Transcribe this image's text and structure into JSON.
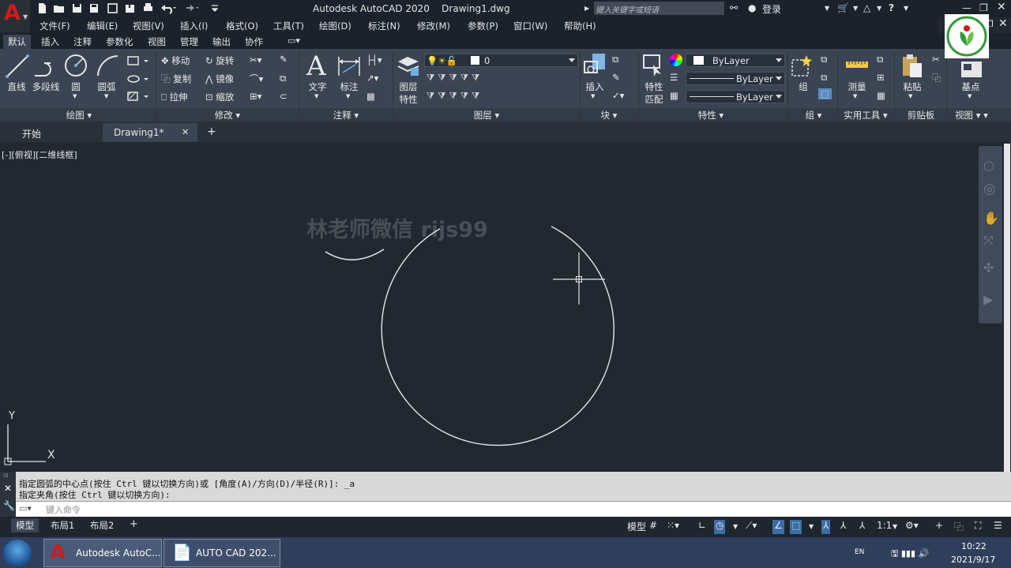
{
  "titlebar": {
    "app_logo": "A",
    "title": "Autodesk AutoCAD 2020    Drawing1.dwg",
    "search_placeholder": "键入关键字或短语",
    "login": "登录"
  },
  "menubar": {
    "items": [
      "文件(F)",
      "编辑(E)",
      "视图(V)",
      "插入(I)",
      "格式(O)",
      "工具(T)",
      "绘图(D)",
      "标注(N)",
      "修改(M)",
      "参数(P)",
      "窗口(W)",
      "帮助(H)"
    ]
  },
  "ribbon_tabs": {
    "items": [
      "默认",
      "插入",
      "注释",
      "参数化",
      "视图",
      "管理",
      "输出",
      "协作"
    ],
    "active": "默认"
  },
  "ribbon": {
    "draw": {
      "title": "绘图",
      "line": "直线",
      "polyline": "多段线",
      "circle": "圆",
      "arc": "圆弧"
    },
    "modify": {
      "title": "修改",
      "move": "移动",
      "rotate": "旋转",
      "copy": "复制",
      "mirror": "镜像",
      "stretch": "拉伸",
      "scale": "缩放"
    },
    "annotation": {
      "title": "注释",
      "text": "文字",
      "dimension": "标注"
    },
    "layers": {
      "title": "图层",
      "layer_props_line1": "图层",
      "layer_props_line2": "特性",
      "current_layer": "0"
    },
    "block": {
      "title": "块",
      "insert": "插入"
    },
    "properties": {
      "title": "特性",
      "match_line1": "特性",
      "match_line2": "匹配",
      "color": "ByLayer",
      "linetype": "ByLayer",
      "lineweight": "ByLayer"
    },
    "groups": {
      "title": "组",
      "group": "组"
    },
    "utilities": {
      "title": "实用工具",
      "measure": "测量"
    },
    "clipboard": {
      "title": "剪贴板",
      "paste": "粘贴"
    },
    "view": {
      "title": "视图",
      "base": "基点"
    }
  },
  "doc_tabs": {
    "start": "开始",
    "drawing": "Drawing1*",
    "close": "✕",
    "add": "+"
  },
  "viewport": {
    "label": "[-][俯视][二维线框]",
    "watermark": "林老师微信 rijs99",
    "ucs_y": "Y",
    "ucs_x": "X"
  },
  "command": {
    "history": [
      "指定圆弧的中心点(按住 Ctrl 键以切换方向)或 [角度(A)/方向(D)/半径(R)]: _a",
      "指定夹角(按住 Ctrl 键以切换方向):"
    ],
    "placeholder": "键入命令"
  },
  "layout_tabs": {
    "items": [
      "模型",
      "布局1",
      "布局2"
    ],
    "active": "模型",
    "add": "+"
  },
  "statusbar": {
    "model": "模型",
    "scale": "1:1"
  },
  "taskbar": {
    "task1": "Autodesk AutoC...",
    "task2": "AUTO  CAD 202...",
    "lang": "EN",
    "time": "10:22",
    "date": "2021/9/17"
  },
  "colors": {
    "app_red": "#d01c1c",
    "ribbon_bg": "#3b4453",
    "canvas_bg": "#212830",
    "accent_blue": "#3c6ea8"
  }
}
